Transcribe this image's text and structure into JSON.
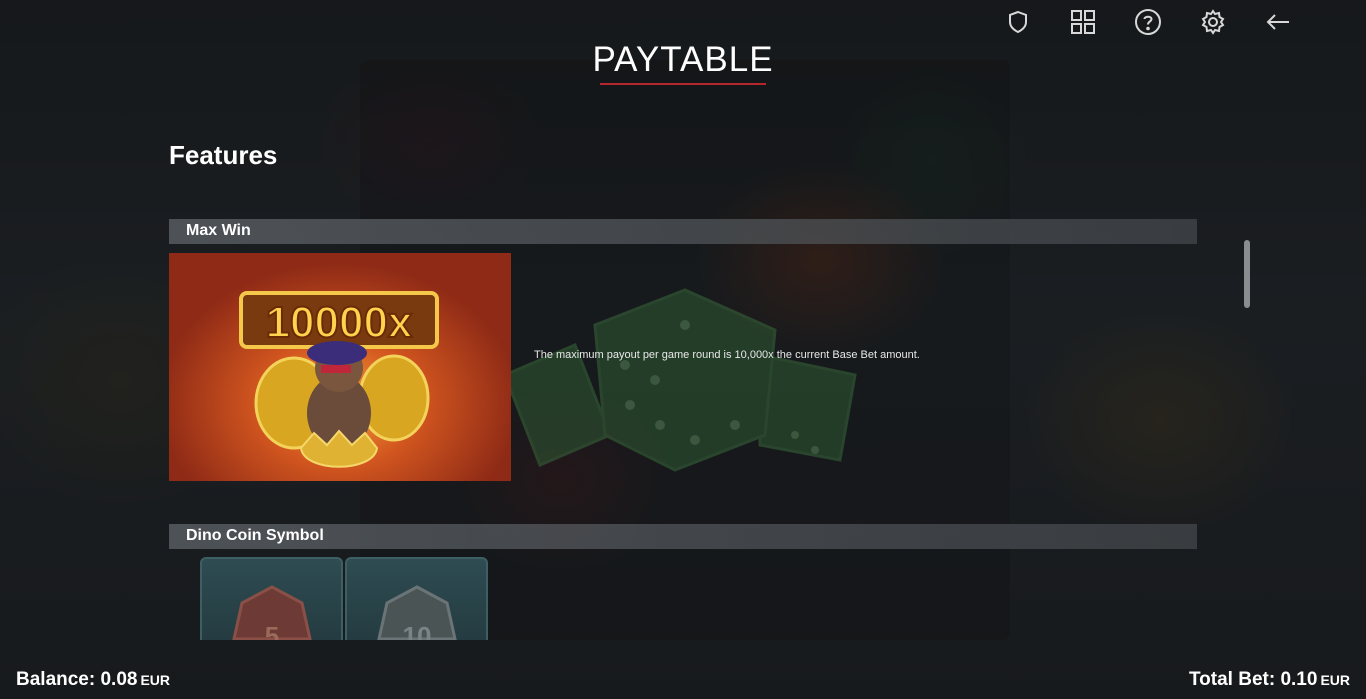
{
  "header": {
    "title": "PAYTABLE",
    "icons": [
      "shield-icon",
      "grid-icon",
      "help-icon",
      "settings-icon",
      "back-arrow-icon"
    ]
  },
  "content": {
    "section_heading": "Features",
    "features": [
      {
        "label": "Max Win",
        "image_text": "10000x",
        "description": "The maximum payout per game round is 10,000x the current Base Bet amount."
      },
      {
        "label": "Dino Coin Symbol",
        "coin_values": [
          "5",
          "10"
        ]
      }
    ]
  },
  "footer": {
    "balance_label": "Balance:",
    "balance_value": "0.08",
    "balance_currency": "EUR",
    "total_bet_label": "Total Bet:",
    "total_bet_value": "0.10",
    "total_bet_currency": "EUR"
  },
  "colors": {
    "title_underline": "#b3272c",
    "section_bar": "#5f6469",
    "text": "#ffffff"
  }
}
